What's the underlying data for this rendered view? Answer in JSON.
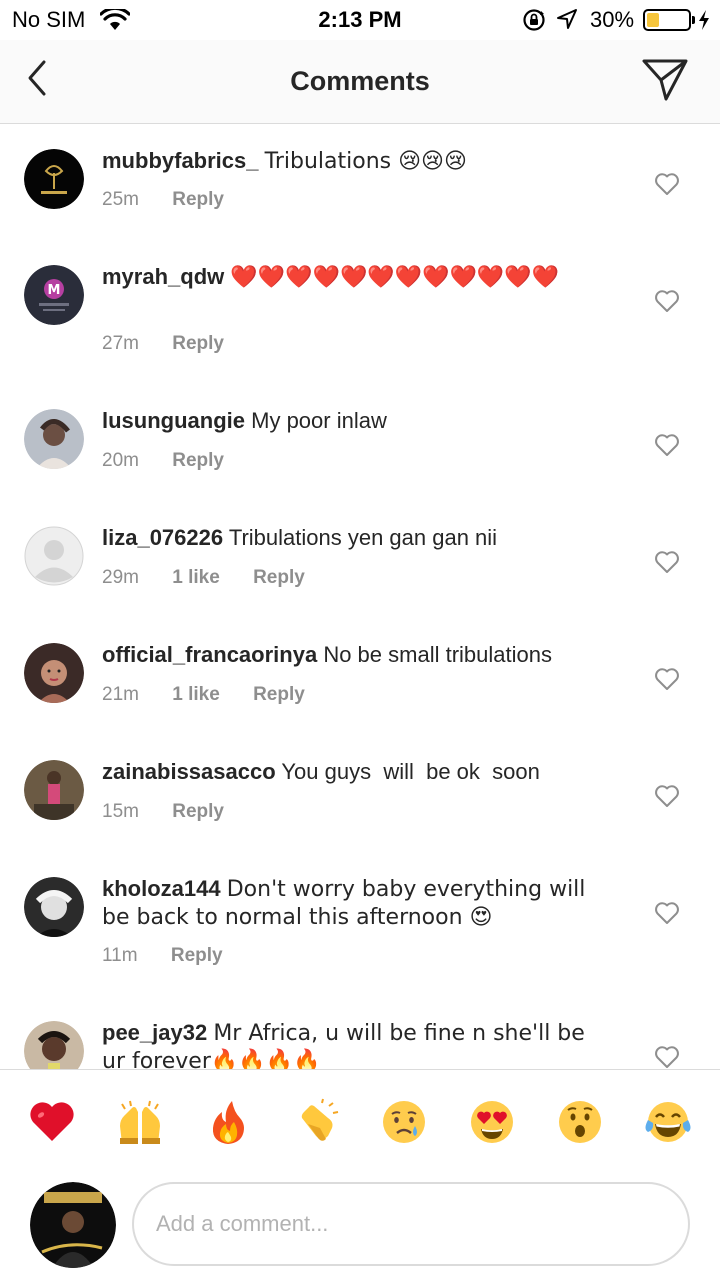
{
  "status_bar": {
    "carrier": "No SIM",
    "time": "2:13 PM",
    "battery_percent": "30%",
    "battery_level": 0.3,
    "battery_color": "#f6c53b"
  },
  "header": {
    "title": "Comments",
    "back_icon": "chevron-left-icon",
    "send_icon": "paper-plane-icon"
  },
  "comments": [
    {
      "username": "mubbyfabrics_",
      "text": "Tribulations 😢😢😢",
      "time": "25m",
      "likes": "",
      "reply": "Reply"
    },
    {
      "username": "myrah_qdw",
      "text": "❤️❤️❤️❤️❤️❤️❤️❤️❤️❤️❤️❤️",
      "time": "27m",
      "likes": "",
      "reply": "Reply"
    },
    {
      "username": "lusunguangie",
      "text": "My poor inlaw",
      "time": "20m",
      "likes": "",
      "reply": "Reply"
    },
    {
      "username": "liza_076226",
      "text": "Tribulations yen gan gan nii",
      "time": "29m",
      "likes": "1 like",
      "reply": "Reply"
    },
    {
      "username": "official_francaorinya",
      "text": "No be small tribulations",
      "time": "21m",
      "likes": "1 like",
      "reply": "Reply"
    },
    {
      "username": "zainabissasacco",
      "text": "You guys  will  be ok  soon",
      "time": "15m",
      "likes": "",
      "reply": "Reply"
    },
    {
      "username": "kholoza144",
      "text": "Don't worry baby everything will be back to normal this afternoon 😍",
      "time": "11m",
      "likes": "",
      "reply": "Reply"
    },
    {
      "username": "pee_jay32",
      "text": "Mr Africa, u will be fine n she'll be ur forever🔥🔥🔥🔥",
      "time": "",
      "likes": "",
      "reply": ""
    }
  ],
  "quick_emojis": [
    "❤️",
    "🙌",
    "🔥",
    "👏",
    "😢",
    "😍",
    "😮",
    "😂"
  ],
  "input": {
    "placeholder": "Add a comment..."
  },
  "colors": {
    "text": "#262626",
    "secondary": "#8e8e8e",
    "divider": "#dbdbdb",
    "header_bg": "#fafafa"
  }
}
